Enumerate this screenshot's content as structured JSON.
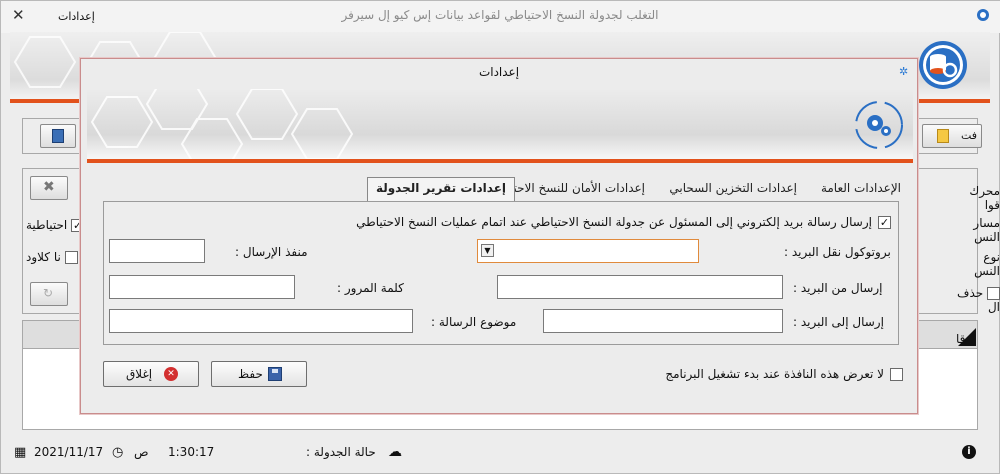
{
  "main_window": {
    "title": "التغلب لجدولة النسخ الاحتياطي لقواعد بيانات إس كيو إل سيرفر",
    "settings_menu": "إعدادات",
    "open_button": "فت",
    "labels": {
      "engine": "محرك قوا",
      "path": "مسار النس",
      "type": "نوع النس",
      "delete": "حذف ال",
      "backup": "احتياطية",
      "cloud": "نا كلاود"
    },
    "grid_header": "قا",
    "status": {
      "schedule_label": "حالة الجدولة :",
      "time": "1:30:17",
      "ampm": "ص",
      "date": "2021/11/17"
    }
  },
  "dialog": {
    "title": "إعدادات",
    "tabs": {
      "general": "الإعدادات العامة",
      "cloud": "إعدادات التخزين السحابي",
      "security": "إعدادات الأمان للنسخ الاحتياطي",
      "report": "إعدادات تقرير الجدولة"
    },
    "send_email_label": "إرسال رسالة بريد إلكتروني إلى المسئول عن جدولة النسخ الاحتياطي عند اتمام عمليات النسخ الاحتياطي",
    "send_email_checked": true,
    "fields": {
      "protocol_label": "بروتوكول نقل البريد :",
      "port_label": "منفذ الإرسال :",
      "sender_label": "إرسال من البريد :",
      "password_label": "كلمة المرور :",
      "recipient_label": "إرسال إلى البريد :",
      "subject_label": "موضوع الرسالة :"
    },
    "hide_on_start_label": "لا تعرض هذه النافذة عند بدء تشغيل البرنامج",
    "hide_on_start_checked": false,
    "save_label": "حفظ",
    "close_label": "إغلاق"
  }
}
